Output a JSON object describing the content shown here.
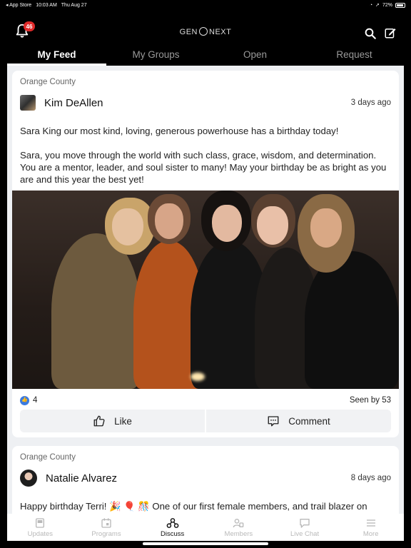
{
  "status_bar": {
    "back_app": "◂ App Store",
    "time": "10:03 AM",
    "date": "Thu Aug 27",
    "battery": "72%"
  },
  "header": {
    "notification_count": "46",
    "logo_left": "GEN",
    "logo_right": "NEXT"
  },
  "tabs": [
    {
      "label": "My Feed",
      "active": true
    },
    {
      "label": "My Groups",
      "active": false
    },
    {
      "label": "Open",
      "active": false
    },
    {
      "label": "Request",
      "active": false
    }
  ],
  "posts": [
    {
      "group": "Orange County",
      "author": "Kim DeAllen",
      "time": "3 days ago",
      "paragraphs": [
        "Sara King our most kind, loving, generous powerhouse has a birthday today!",
        "Sara, you move through the world with such class, grace, wisdom, and determination. You are a mentor, leader, and soul sister to many! May your birthday be as bright as you are and this year the best yet!"
      ],
      "like_count": "4",
      "seen": "Seen by 53",
      "like_label": "Like",
      "comment_label": "Comment"
    },
    {
      "group": "Orange County",
      "author": "Natalie Alvarez",
      "time": "8 days ago",
      "text": "Happy birthday Terri! 🎉 🎈 🎊 One of our first female members, and trail blazer on"
    }
  ],
  "bottom_nav": [
    {
      "label": "Updates",
      "icon": "updates-icon",
      "active": false
    },
    {
      "label": "Programs",
      "icon": "calendar-icon",
      "active": false
    },
    {
      "label": "Discuss",
      "icon": "discuss-icon",
      "active": true
    },
    {
      "label": "Members",
      "icon": "members-icon",
      "active": false
    },
    {
      "label": "Live Chat",
      "icon": "chat-icon",
      "active": false
    },
    {
      "label": "More",
      "icon": "menu-icon",
      "active": false
    }
  ],
  "colors": {
    "badge": "#e02a2a",
    "like_reaction": "#3b7be0",
    "feed_background": "#eef0f3"
  }
}
